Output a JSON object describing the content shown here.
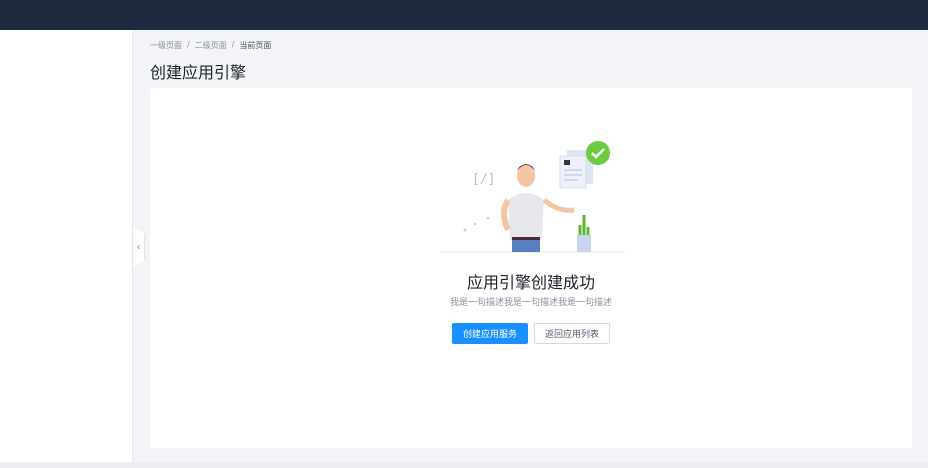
{
  "breadcrumb": [
    "一级页面",
    "二级页面",
    "当前页面"
  ],
  "separator": "/",
  "page_title": "创建应用引擎",
  "result": {
    "title": "应用引擎创建成功",
    "description": "我是一句描述我是一句描述我是一句描述",
    "primary_button": "创建应用服务",
    "secondary_button": "返回应用列表"
  },
  "collapse_icon": "‹",
  "colors": {
    "header": "#1f2a3f",
    "primary": "#1890ff",
    "success": "#52c41a"
  }
}
